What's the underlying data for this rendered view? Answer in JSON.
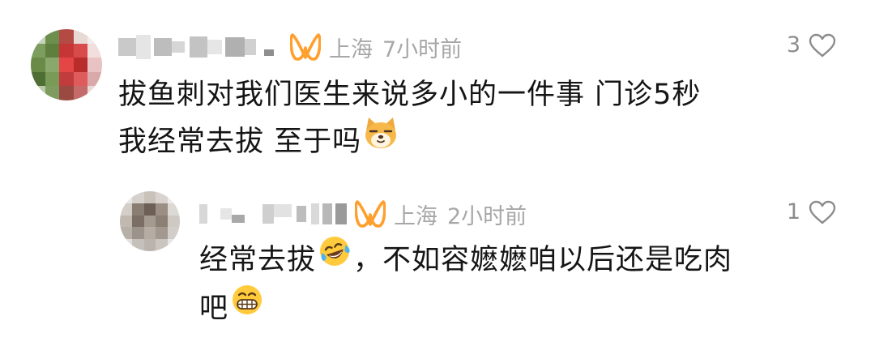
{
  "comments": [
    {
      "location": "上海",
      "time": "7小时前",
      "likes": "3",
      "text_line1": "拔鱼刺对我们医生来说多小的一件事 门诊5秒",
      "text_line2": "我经常去拔 至于吗",
      "emoji": "dog-face-emoji"
    },
    {
      "location": "上海",
      "time": "2小时前",
      "likes": "1",
      "text_line1_before": "经常去拔",
      "emoji_1": "face-with-tears-of-joy-emoji",
      "text_line1_after": "，不如容嬷嬷咱以后还是吃肉",
      "text_line2": "吧",
      "emoji_2": "grinning-face-emoji"
    }
  ],
  "colors": {
    "badge": "#ff9f2d",
    "meta_text": "#a7a7a7",
    "like_count": "#8c8c8c",
    "body_text": "#151515"
  },
  "icons": {
    "badge": "honor-badge-icon",
    "like": "heart-outline-icon"
  }
}
